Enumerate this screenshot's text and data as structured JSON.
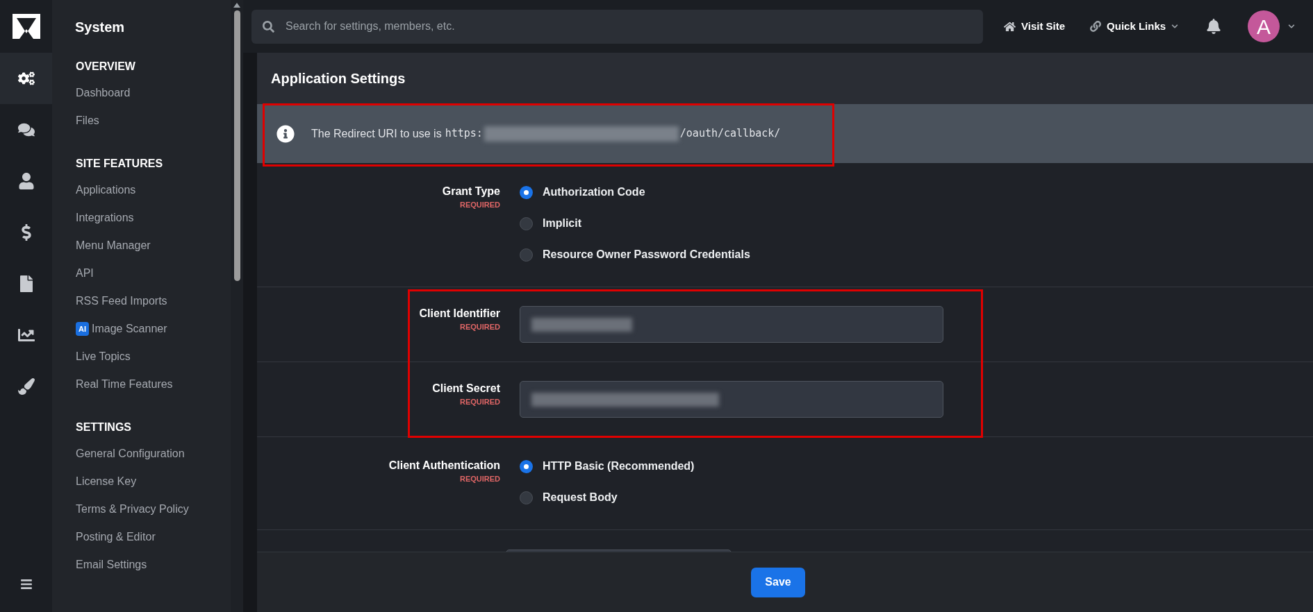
{
  "rail": [
    {
      "kind": "settings",
      "selected": true
    },
    {
      "kind": "comments",
      "selected": false
    },
    {
      "kind": "user",
      "selected": false
    },
    {
      "kind": "dollar",
      "selected": false
    },
    {
      "kind": "file",
      "selected": false
    },
    {
      "kind": "chart",
      "selected": false
    },
    {
      "kind": "brush",
      "selected": false
    }
  ],
  "sidebar": {
    "title": "System",
    "sections": [
      {
        "heading": "OVERVIEW",
        "items": [
          {
            "label": "Dashboard"
          },
          {
            "label": "Files"
          }
        ]
      },
      {
        "heading": "SITE FEATURES",
        "items": [
          {
            "label": "Applications"
          },
          {
            "label": "Integrations"
          },
          {
            "label": "Menu Manager"
          },
          {
            "label": "API"
          },
          {
            "label": "RSS Feed Imports"
          },
          {
            "label": "Image Scanner",
            "badge": "AI"
          },
          {
            "label": "Live Topics"
          },
          {
            "label": "Real Time Features"
          }
        ]
      },
      {
        "heading": "SETTINGS",
        "items": [
          {
            "label": "General Configuration"
          },
          {
            "label": "License Key"
          },
          {
            "label": "Terms & Privacy Policy"
          },
          {
            "label": "Posting & Editor"
          },
          {
            "label": "Email Settings"
          }
        ]
      }
    ]
  },
  "topbar": {
    "search_placeholder": "Search for settings, members, etc.",
    "visit_site": "Visit Site",
    "quick_links": "Quick Links",
    "avatar": "A"
  },
  "panel": {
    "title": "Application Settings",
    "notice": {
      "text": "The Redirect URI to use is",
      "uri_start": "https:",
      "uri_end": "/oauth/callback/"
    },
    "rows": [
      {
        "kind": "radio",
        "label": "Grant Type",
        "required": "REQUIRED",
        "options": [
          {
            "label": "Authorization Code",
            "selected": true
          },
          {
            "label": "Implicit",
            "selected": false
          },
          {
            "label": "Resource Owner Password Credentials",
            "selected": false
          }
        ]
      },
      {
        "kind": "text",
        "label": "Client Identifier",
        "required": "REQUIRED"
      },
      {
        "kind": "text",
        "label": "Client Secret",
        "required": "REQUIRED"
      },
      {
        "kind": "radio",
        "label": "Client Authentication",
        "required": "REQUIRED",
        "options": [
          {
            "label": "HTTP Basic (Recommended)",
            "selected": true
          },
          {
            "label": "Request Body",
            "selected": false
          }
        ]
      }
    ],
    "save": "Save"
  }
}
